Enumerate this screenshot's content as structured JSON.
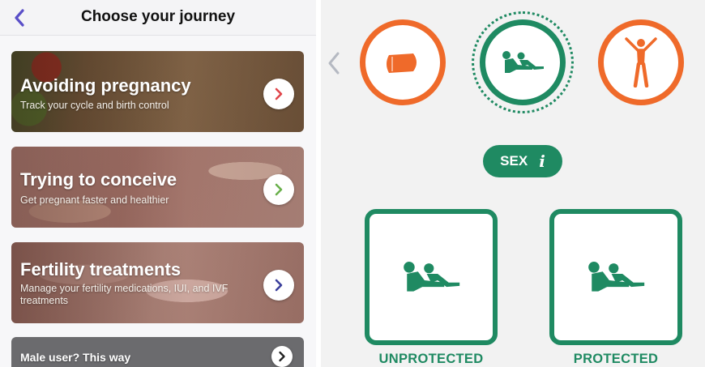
{
  "left_screen": {
    "header": {
      "title": "Choose your journey",
      "back_icon": "chevron-left-icon"
    },
    "cards": [
      {
        "title": "Avoiding pregnancy",
        "subtitle": "Track your cycle and birth control",
        "arrow_color": "#e0454a"
      },
      {
        "title": "Trying to conceive",
        "subtitle": "Get pregnant faster and healthier",
        "arrow_color": "#6ab04c"
      },
      {
        "title": "Fertility treatments",
        "subtitle": "Manage your fertility medications, IUI, and IVF treatments",
        "arrow_color": "#3b3f9c"
      },
      {
        "title": "Male user? This way",
        "arrow_color": "#222222"
      }
    ]
  },
  "right_screen": {
    "back_icon": "chevron-left-icon",
    "categories": [
      {
        "icon": "pad-icon",
        "color": "#ef6a2a",
        "selected": false
      },
      {
        "icon": "sex-icon",
        "color": "#1f8a62",
        "selected": true
      },
      {
        "icon": "person-arms-up-icon",
        "color": "#ef6a2a",
        "selected": false
      }
    ],
    "selected_label": "SEX",
    "info_glyph": "i",
    "options": [
      {
        "label": "UNPROTECTED",
        "icon": "sex-icon"
      },
      {
        "label": "PROTECTED",
        "icon": "sex-icon"
      }
    ],
    "colors": {
      "green": "#1f8a62",
      "orange": "#ef6a2a"
    }
  }
}
